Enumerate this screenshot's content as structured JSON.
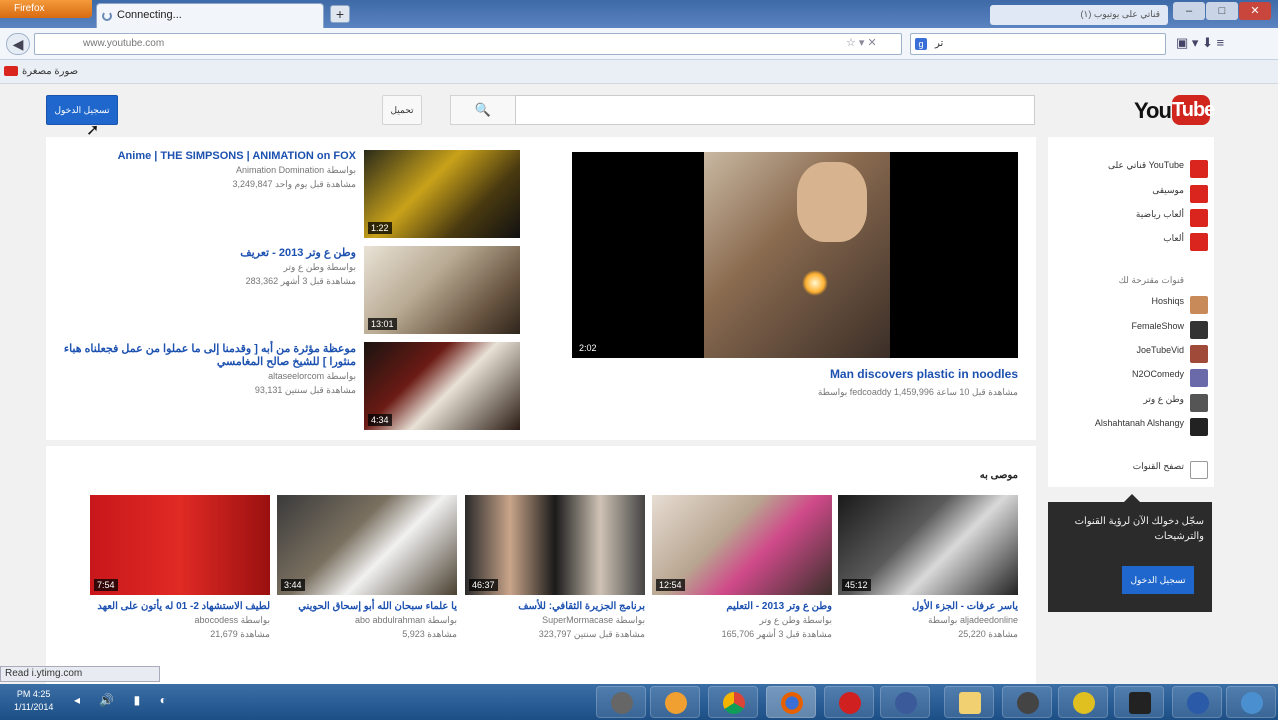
{
  "browser": {
    "menu_button": "Firefox",
    "tab_title": "Connecting...",
    "new_tab": "+",
    "right_tab": "(۱) قناتي على يوتيوب",
    "url": "www.youtube.com",
    "search_value": "تر",
    "search_engine_letter": "g",
    "bookmark_label": "صورة مصغرة",
    "status": "Read i.ytimg.com"
  },
  "masthead": {
    "signin": "تسجيل الدخول",
    "upload": "تحميل",
    "search_placeholder": "",
    "logo_you": "You",
    "logo_tube": "Tube"
  },
  "featured": {
    "title": "Man discovers plastic in noodles",
    "meta": "بواسطة fedcoaddy 1,459,996 مشاهدة قبل 10 ساعة",
    "duration": "2:02"
  },
  "side_videos": [
    {
      "title": "Anime | THE SIMPSONS | ANIMATION on FOX",
      "channel": "Animation Domination بواسطة",
      "meta": "3,249,847 مشاهدة قبل يوم واحد",
      "duration": "1:22"
    },
    {
      "title": "وطن ع وتر 2013 - تعريف",
      "channel": "بواسطة وطن ع وتر",
      "meta": "283,362 مشاهدة قبل 3 أشهر",
      "duration": "13:01"
    },
    {
      "title": "موعظة مؤثرة من أبه [ وقدمنا إلى ما عملوا من عمل فجعلناه هباء منثورا ] للشيخ صالح المغامسي",
      "channel": "altaseelorcom بواسطة",
      "meta": "93,131 مشاهدة قبل سنتين",
      "duration": "4:34"
    }
  ],
  "sidebar": {
    "nav": [
      {
        "label": "قناتي على YouTube",
        "color": "#d9251d"
      },
      {
        "label": "موسيقى",
        "color": "#d9251d"
      },
      {
        "label": "ألعاب رياضية",
        "color": "#d9251d"
      },
      {
        "label": "ألعاب",
        "color": "#d9251d"
      }
    ],
    "section_title": "قنوات مقترحة لك",
    "channels": [
      {
        "label": "Hoshiqs",
        "color": "#c98a5a"
      },
      {
        "label": "FemaleShow",
        "color": "#333"
      },
      {
        "label": "JoeTubeVid",
        "color": "#a04a3a"
      },
      {
        "label": "N2OComedy",
        "color": "#6a6aaa"
      },
      {
        "label": "وطن ع وتر",
        "color": "#555"
      },
      {
        "label": "Alshahtanah Alshangy",
        "color": "#222"
      }
    ],
    "browse": "تصفح القنوات"
  },
  "recommended": {
    "heading": "موصى به",
    "videos": [
      {
        "title": "ياسر عرفات - الجزء الأول",
        "channel": "بواسطة aljadeedonline",
        "meta": "25,220 مشاهدة",
        "duration": "45:12"
      },
      {
        "title": "وطن ع وتر 2013 - التعليم",
        "channel": "بواسطة وطن ع وتر",
        "meta": "165,706 مشاهدة قبل 3 أشهر",
        "duration": "12:54"
      },
      {
        "title": "برنامج الجزيرة الثقافي: للأسف",
        "channel": "SuperMormacase بواسطة",
        "meta": "323,797 مشاهدة قبل سنتين",
        "duration": "46:37"
      },
      {
        "title": "يا علماء سبحان الله أبو إسحاق الحويني",
        "channel": "abo abdulrahman بواسطة",
        "meta": "5,923 مشاهدة",
        "duration": "3:44"
      },
      {
        "title": "لطيف الاستشهاد 2- 01 له يأتون على العهد",
        "channel": "abocodess بواسطة",
        "meta": "21,679 مشاهدة",
        "duration": "7:54"
      }
    ]
  },
  "promo": {
    "text": "سجّل دخولك الآن لرؤية القنوات والترشيحات",
    "button": "تسجيل الدخول"
  },
  "taskbar": {
    "time": "PM 4:25",
    "date": "1/11/2014"
  }
}
